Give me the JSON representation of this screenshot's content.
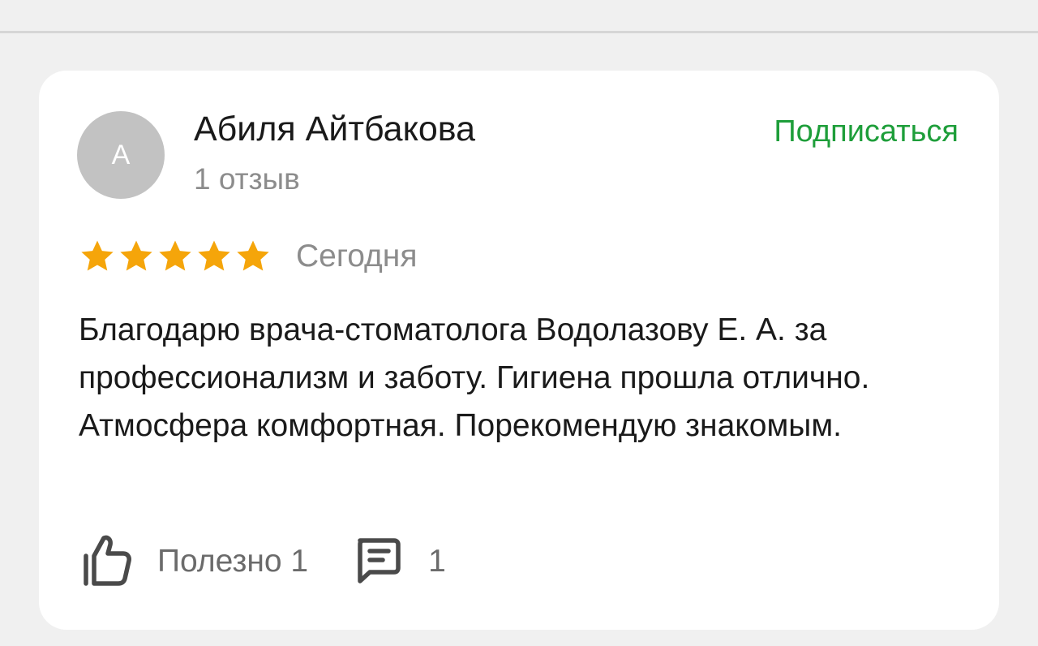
{
  "review": {
    "author": {
      "initial": "А",
      "name": "Абиля Айтбакова",
      "reviews_count": "1 отзыв"
    },
    "subscribe_label": "Подписаться",
    "rating": {
      "value": 5,
      "max": 5
    },
    "date": "Сегодня",
    "text": "Благодарю врача-стоматолога Водолазову Е. А. за профессионализм и заботу. Гигиена прошла отлично. Атмосфера комфортная. Порекомендую знакомым.",
    "helpful_label": "Полезно 1",
    "comments_count": "1",
    "icons": {
      "thumb": "thumbs-up-icon",
      "comment": "comment-icon",
      "star": "star-icon"
    }
  },
  "colors": {
    "accent_green": "#1e9e3a",
    "star": "#f5a50a",
    "avatar_bg": "#c2c2c2",
    "muted_text": "#8c8c8c"
  }
}
